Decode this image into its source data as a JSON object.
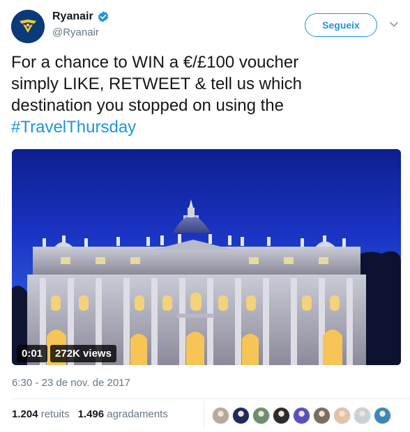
{
  "tweet": {
    "author_name": "Ryanair",
    "author_handle": "@Ryanair",
    "follow_label": "Segueix",
    "text_lines": [
      "For a chance to WIN a €/£100 voucher",
      "simply LIKE, RETWEET & tell us which",
      "destination you stopped on using the"
    ],
    "hashtag": "#TravelThursday",
    "video_time": "0:01",
    "video_views": "272K views",
    "timestamp": "6:30 - 23 de nov. de 2017",
    "retweets_count": "1.204",
    "retweets_label": "retuits",
    "likes_count": "1.496",
    "likes_label": "agradaments"
  },
  "colors": {
    "brand_blue": "#1c94e0",
    "ryanair_navy": "#0b3a78",
    "ryanair_gold": "#f1c933",
    "muted_text": "#657786"
  },
  "icons": {
    "verified": "verified-badge-icon",
    "caret": "chevron-down-icon"
  },
  "likers": [
    {
      "color": "#b8a89a"
    },
    {
      "color": "#1e2b5c"
    },
    {
      "color": "#6b8f6f"
    },
    {
      "color": "#2c2c2c"
    },
    {
      "color": "#5a4fc0"
    },
    {
      "color": "#7a6e5c"
    },
    {
      "color": "#e2c3a8"
    },
    {
      "color": "#c9d1d8"
    },
    {
      "color": "#3d86b8"
    }
  ]
}
